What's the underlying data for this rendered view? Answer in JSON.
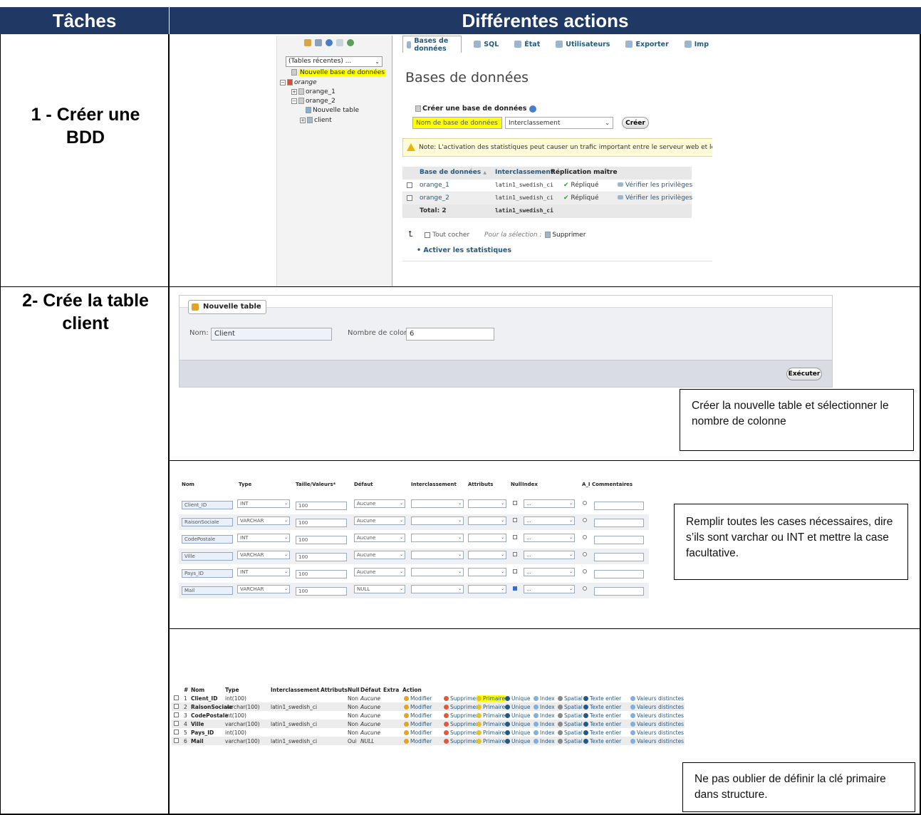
{
  "header": {
    "col1": "Tâches",
    "col2": "Différentes actions"
  },
  "tasks": {
    "t1": "1 - Créer une BDD",
    "t2": "2- Crée la table client"
  },
  "notes": {
    "n1": "Créer la nouvelle table et sélectionner le nombre de colonne",
    "n2": "Remplir toutes les cases nécessaires, dire s’ils sont varchar ou INT et mettre la case facultative.",
    "n3": "Ne pas oublier de définir la clé primaire dans structure."
  },
  "pma_databases": {
    "recent_tables": "(Tables récentes) ...",
    "tree": {
      "new_db": "Nouvelle base de données",
      "db": "orange",
      "db1": "orange_1",
      "db2": "orange_2",
      "new_table": "Nouvelle table",
      "table": "client"
    },
    "tabs": [
      "Bases de données",
      "SQL",
      "État",
      "Utilisateurs",
      "Exporter",
      "Imp"
    ],
    "title": "Bases de données",
    "create_label": "Créer une base de données",
    "name_placeholder": "Nom de base de données",
    "collation_select": "Interclassement",
    "create_button": "Créer",
    "notice": "Note: L'activation des statistiques peut causer un trafic important entre le serveur web et le serv",
    "table_headers": {
      "db": "Base de données",
      "sort": "▲",
      "collation": "Interclassement",
      "replication": "Réplication maître"
    },
    "rows": [
      {
        "name": "orange_1",
        "collation": "latin1_swedish_ci",
        "replication": "Répliqué",
        "action": "Vérifier les privilèges"
      },
      {
        "name": "orange_2",
        "collation": "latin1_swedish_ci",
        "replication": "Répliqué",
        "action": "Vérifier les privilèges"
      }
    ],
    "total_label": "Total: 2",
    "total_collation": "latin1_swedish_ci",
    "check_all": "Tout cocher",
    "for_selection": "Pour la sélection :",
    "delete": "Supprimer",
    "enable_stats": "Activer les statistiques"
  },
  "pma_newtable": {
    "legend": "Nouvelle table",
    "name_label": "Nom:",
    "name_value": "Client",
    "columns_label": "Nombre de colonnes:",
    "columns_value": "6",
    "execute_button": "Exécuter"
  },
  "pma_columns": {
    "headers": [
      "Nom",
      "Type",
      "Taille/Valeurs*",
      "Défaut",
      "Interclassement",
      "Attributs",
      "Null",
      "Index",
      "A_I",
      "Commentaires"
    ],
    "rows": [
      {
        "name": "Client_ID",
        "type": "INT",
        "size": "100",
        "default": "Aucune",
        "null": false,
        "index": "..."
      },
      {
        "name": "RaisonSociale",
        "type": "VARCHAR",
        "size": "100",
        "default": "Aucune",
        "null": false,
        "index": "..."
      },
      {
        "name": "CodePostale",
        "type": "INT",
        "size": "100",
        "default": "Aucune",
        "null": false,
        "index": "..."
      },
      {
        "name": "Ville",
        "type": "VARCHAR",
        "size": "100",
        "default": "Aucune",
        "null": false,
        "index": "..."
      },
      {
        "name": "Pays_ID",
        "type": "INT",
        "size": "100",
        "default": "Aucune",
        "null": false,
        "index": "..."
      },
      {
        "name": "Mail",
        "type": "VARCHAR",
        "size": "100",
        "default": "NULL",
        "null": true,
        "index": "..."
      }
    ]
  },
  "pma_structure": {
    "headers": {
      "num": "#",
      "name": "Nom",
      "type": "Type",
      "collation": "Interclassement",
      "attributes": "Attributs",
      "null": "Null",
      "default": "Défaut",
      "extra": "Extra",
      "action": "Action"
    },
    "actions": [
      "Modifier",
      "Supprimer",
      "Primaire",
      "Unique",
      "Index",
      "Spatial",
      "Texte entier",
      "Valeurs distinctes"
    ],
    "rows": [
      {
        "num": "1",
        "name": "Client_ID",
        "type": "int(100)",
        "collation": "",
        "null": "Non",
        "default": "Aucune"
      },
      {
        "num": "2",
        "name": "RaisonSociale",
        "type": "varchar(100)",
        "collation": "latin1_swedish_ci",
        "null": "Non",
        "default": "Aucune"
      },
      {
        "num": "3",
        "name": "CodePostale",
        "type": "int(100)",
        "collation": "",
        "null": "Non",
        "default": "Aucune"
      },
      {
        "num": "4",
        "name": "Ville",
        "type": "varchar(100)",
        "collation": "latin1_swedish_ci",
        "null": "Non",
        "default": "Aucune"
      },
      {
        "num": "5",
        "name": "Pays_ID",
        "type": "int(100)",
        "collation": "",
        "null": "Non",
        "default": "Aucune"
      },
      {
        "num": "6",
        "name": "Mail",
        "type": "varchar(100)",
        "collation": "latin1_swedish_ci",
        "null": "Oui",
        "default": "NULL"
      }
    ]
  },
  "colors": {
    "header_bg": "#1f3864",
    "highlight": "#ffff00",
    "link": "#235a81"
  }
}
